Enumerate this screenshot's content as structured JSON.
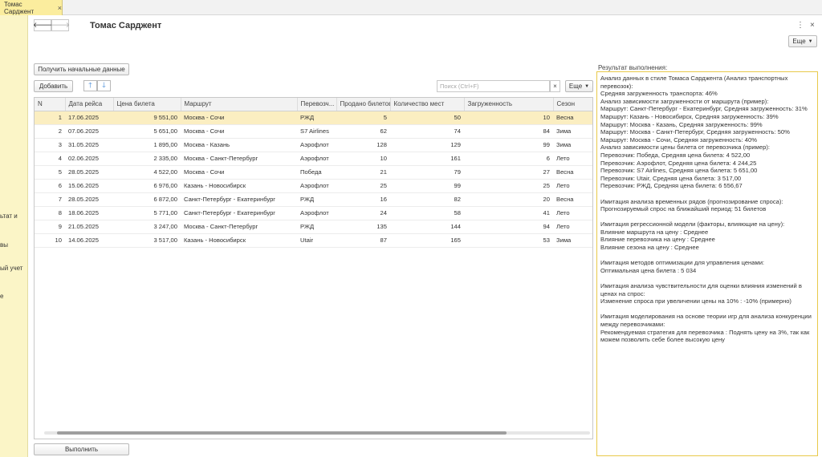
{
  "tab": {
    "label": "Томас Сарджент"
  },
  "left_panel": {
    "fragments": [
      "ьтат и",
      "вы",
      "ый учет",
      "е"
    ]
  },
  "header": {
    "title": "Томас Сарджент",
    "more_label": "Еще"
  },
  "toolbar": {
    "get_data_label": "Получить начальные данные",
    "add_label": "Добавить",
    "search_placeholder": "Поиск (Ctrl+F)",
    "more_label": "Еще"
  },
  "table": {
    "columns": [
      "N",
      "Дата рейса",
      "Цена билета",
      "Маршрут",
      "Перевозч...",
      "Продано билетов",
      "Количество мест",
      "Загруженность",
      "Сезон"
    ],
    "rows": [
      [
        "1",
        "17.06.2025",
        "9 551,00",
        "Москва - Сочи",
        "РЖД",
        "5",
        "50",
        "10",
        "Весна"
      ],
      [
        "2",
        "07.06.2025",
        "5 651,00",
        "Москва - Сочи",
        "S7 Airlines",
        "62",
        "74",
        "84",
        "Зима"
      ],
      [
        "3",
        "31.05.2025",
        "1 895,00",
        "Москва - Казань",
        "Аэрофлот",
        "128",
        "129",
        "99",
        "Зима"
      ],
      [
        "4",
        "02.06.2025",
        "2 335,00",
        "Москва - Санкт-Петербург",
        "Аэрофлот",
        "10",
        "161",
        "6",
        "Лето"
      ],
      [
        "5",
        "28.05.2025",
        "4 522,00",
        "Москва - Сочи",
        "Победа",
        "21",
        "79",
        "27",
        "Весна"
      ],
      [
        "6",
        "15.06.2025",
        "6 976,00",
        "Казань - Новосибирск",
        "Аэрофлот",
        "25",
        "99",
        "25",
        "Лето"
      ],
      [
        "7",
        "28.05.2025",
        "6 872,00",
        "Санкт-Петербург - Екатеринбург",
        "РЖД",
        "16",
        "82",
        "20",
        "Весна"
      ],
      [
        "8",
        "18.06.2025",
        "5 771,00",
        "Санкт-Петербург - Екатеринбург",
        "Аэрофлот",
        "24",
        "58",
        "41",
        "Лето"
      ],
      [
        "9",
        "21.05.2025",
        "3 247,00",
        "Москва - Санкт-Петербург",
        "РЖД",
        "135",
        "144",
        "94",
        "Лето"
      ],
      [
        "10",
        "14.06.2025",
        "3 517,00",
        "Казань - Новосибирск",
        "Utair",
        "87",
        "165",
        "53",
        "Зима"
      ]
    ]
  },
  "execute_label": "Выполнить",
  "result": {
    "label": "Результат выполнения:",
    "lines": [
      "Анализ данных в стиле Томаса Сарджента (Анализ транспортных",
      "перевозок):",
      "Средняя загруженность транспорта: 46%",
      "Анализ зависимости загруженности от маршрута (пример):",
      "Маршрут: Санкт-Петербург - Екатеринбург, Средняя загруженность: 31%",
      "Маршрут: Казань - Новосибирск, Средняя загруженность: 39%",
      "Маршрут: Москва - Казань, Средняя загруженность: 99%",
      "Маршрут: Москва - Санкт-Петербург, Средняя загруженность: 50%",
      "Маршрут: Москва - Сочи, Средняя загруженность: 40%",
      "Анализ зависимости цены билета от перевозчика (пример):",
      "Перевозчик: Победа, Средняя цена билета: 4 522,00",
      "Перевозчик: Аэрофлот, Средняя цена билета: 4 244,25",
      "Перевозчик: S7 Airlines, Средняя цена билета: 5 651,00",
      "Перевозчик: Utair, Средняя цена билета: 3 517,00",
      "Перевозчик: РЖД, Средняя цена билета: 6 556,67",
      "",
      "Имитация анализа временных рядов (прогнозирование спроса):",
      "Прогнозируемый спрос на ближайший период: 51 билетов",
      "",
      "Имитация регрессионной модели (факторы, влияющие на цену):",
      "Влияние маршрута на цену : Среднее",
      "Влияние перевозчика на цену : Среднее",
      "Влияние сезона на цену : Среднее",
      "",
      "Имитация методов оптимизации для управления ценами:",
      "Оптимальная цена билета : 5 034",
      "",
      "Имитация анализа чувствительности для оценки влияния изменений в",
      "ценах на спрос:",
      "Изменение спроса при увеличении цены на 10% : -10% (примерно)",
      "",
      "Имитация моделирования на основе теории игр для анализа конкуренции",
      "между перевозчиками:",
      "Рекомендуемая стратегия для перевозчика : Поднять цену на 3%, так как",
      "можем позволить себе более высокую цену"
    ]
  }
}
